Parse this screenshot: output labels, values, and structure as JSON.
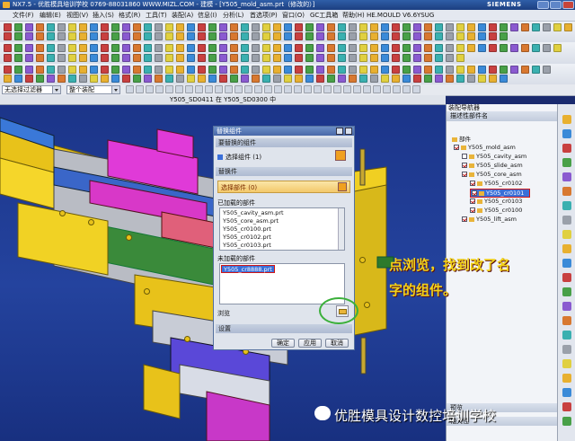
{
  "window": {
    "title": "NX7.5 - 优胜模具培训学校 0769-88031860 WWW.MIZL.COM - 建模 - [Y505_mold_asm.prt（修改的）]",
    "brand": "SIEMENS"
  },
  "menu": [
    "文件(F)",
    "编辑(E)",
    "视图(V)",
    "插入(S)",
    "格式(R)",
    "工具(T)",
    "装配(A)",
    "信息(I)",
    "分析(L)",
    "首选项(P)",
    "窗口(O)",
    "GC工具箱",
    "帮助(H)",
    "HE.MOULD V6.6",
    "YSUG"
  ],
  "selection_bar": {
    "filter": "无选择过滤器",
    "scope": "整个装配"
  },
  "viewport_title": "Y505_SD0411 在 Y505_SD0300 中",
  "dialog": {
    "title": "替换组件",
    "section_replace": "要替换的组件",
    "selected_component": "选择组件 (1)",
    "section_replacement": "替换件",
    "select_part": "选择部件 (0)",
    "loaded_parts_label": "已加载的部件",
    "loaded_parts": [
      "Y505_cavity_asm.prt",
      "Y505_core_asm.prt",
      "Y505_cr0100.prt",
      "Y505_cr0102.prt",
      "Y505_cr0103.prt"
    ],
    "unloaded_parts_label": "未加载的部件",
    "unloaded_parts": [
      "Y505_cr8888.prt"
    ],
    "browse_label": "浏览",
    "settings_label": "设置",
    "ok_label": "确定",
    "apply_label": "应用",
    "cancel_label": "取消"
  },
  "annotation": {
    "line1": "点浏览，找到改了名",
    "line2": "字的组件。"
  },
  "navigator": {
    "title": "装配导航器",
    "column": "描述性部件名",
    "section_label": "部件",
    "items": [
      {
        "label": "Y505_mold_asm",
        "level": 0,
        "checked": true
      },
      {
        "label": "Y505_cavity_asm",
        "level": 1,
        "checked": false
      },
      {
        "label": "Y505_slide_asm",
        "level": 1,
        "checked": true
      },
      {
        "label": "Y505_core_asm",
        "level": 1,
        "checked": true
      },
      {
        "label": "Y505_cr0102",
        "level": 2,
        "checked": true
      },
      {
        "label": "Y505_cr0101",
        "level": 2,
        "checked": true,
        "highlight": true
      },
      {
        "label": "Y505_cr0103",
        "level": 2,
        "checked": true
      },
      {
        "label": "Y505_cr0100",
        "level": 2,
        "checked": true
      },
      {
        "label": "Y505_lift_asm",
        "level": 1,
        "checked": true
      }
    ],
    "footer_1": "预览",
    "footer_2": "相关性"
  },
  "watermark": "优胜模具设计数控培训学校",
  "colors": {
    "accent_red": "#d21616",
    "note_yellow": "#f2d21a",
    "circle_green": "#3bb03b",
    "selection_blue": "#3a6fd8"
  }
}
